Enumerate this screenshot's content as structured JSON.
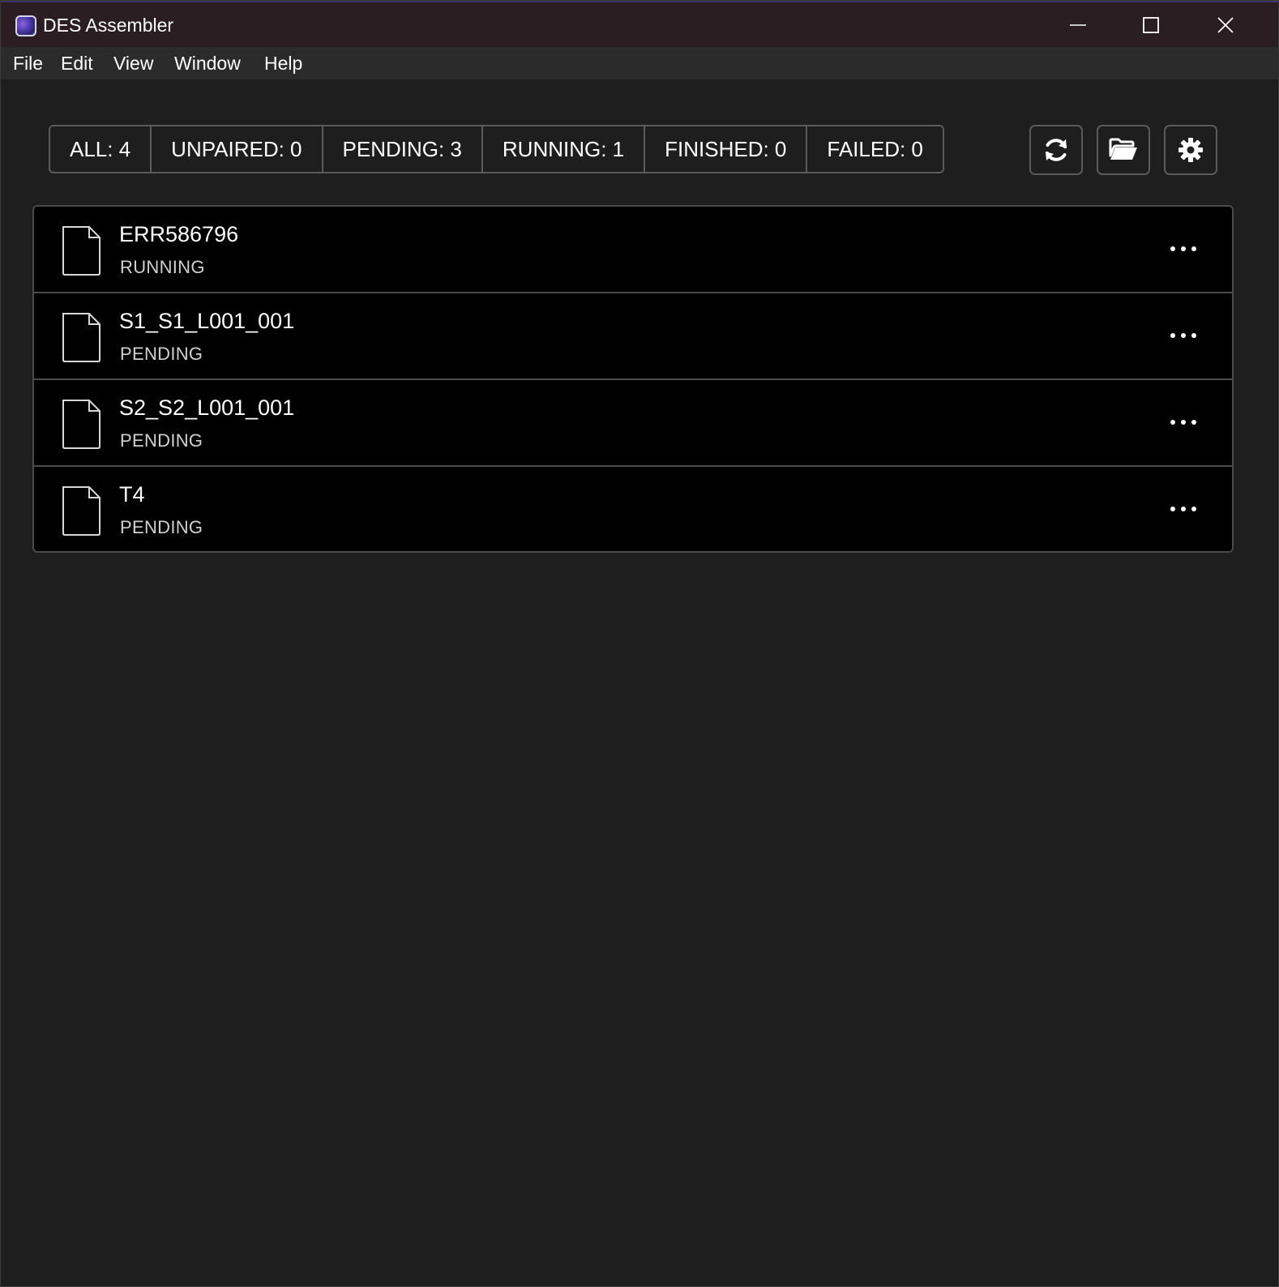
{
  "window": {
    "title": "DES Assembler"
  },
  "menu": {
    "items": [
      "File",
      "Edit",
      "View",
      "Window",
      "Help"
    ]
  },
  "filters": [
    {
      "label": "ALL: 4"
    },
    {
      "label": "UNPAIRED: 0"
    },
    {
      "label": "PENDING: 3"
    },
    {
      "label": "RUNNING: 1"
    },
    {
      "label": "FINISHED: 0"
    },
    {
      "label": "FAILED: 0"
    }
  ],
  "toolbar": {
    "icons": [
      "refresh-icon",
      "folder-open-icon",
      "gear-icon"
    ]
  },
  "jobs": [
    {
      "name": "ERR586796",
      "status": "RUNNING"
    },
    {
      "name": "S1_S1_L001_001",
      "status": "PENDING"
    },
    {
      "name": "S2_S2_L001_001",
      "status": "PENDING"
    },
    {
      "name": "T4",
      "status": "PENDING"
    }
  ]
}
